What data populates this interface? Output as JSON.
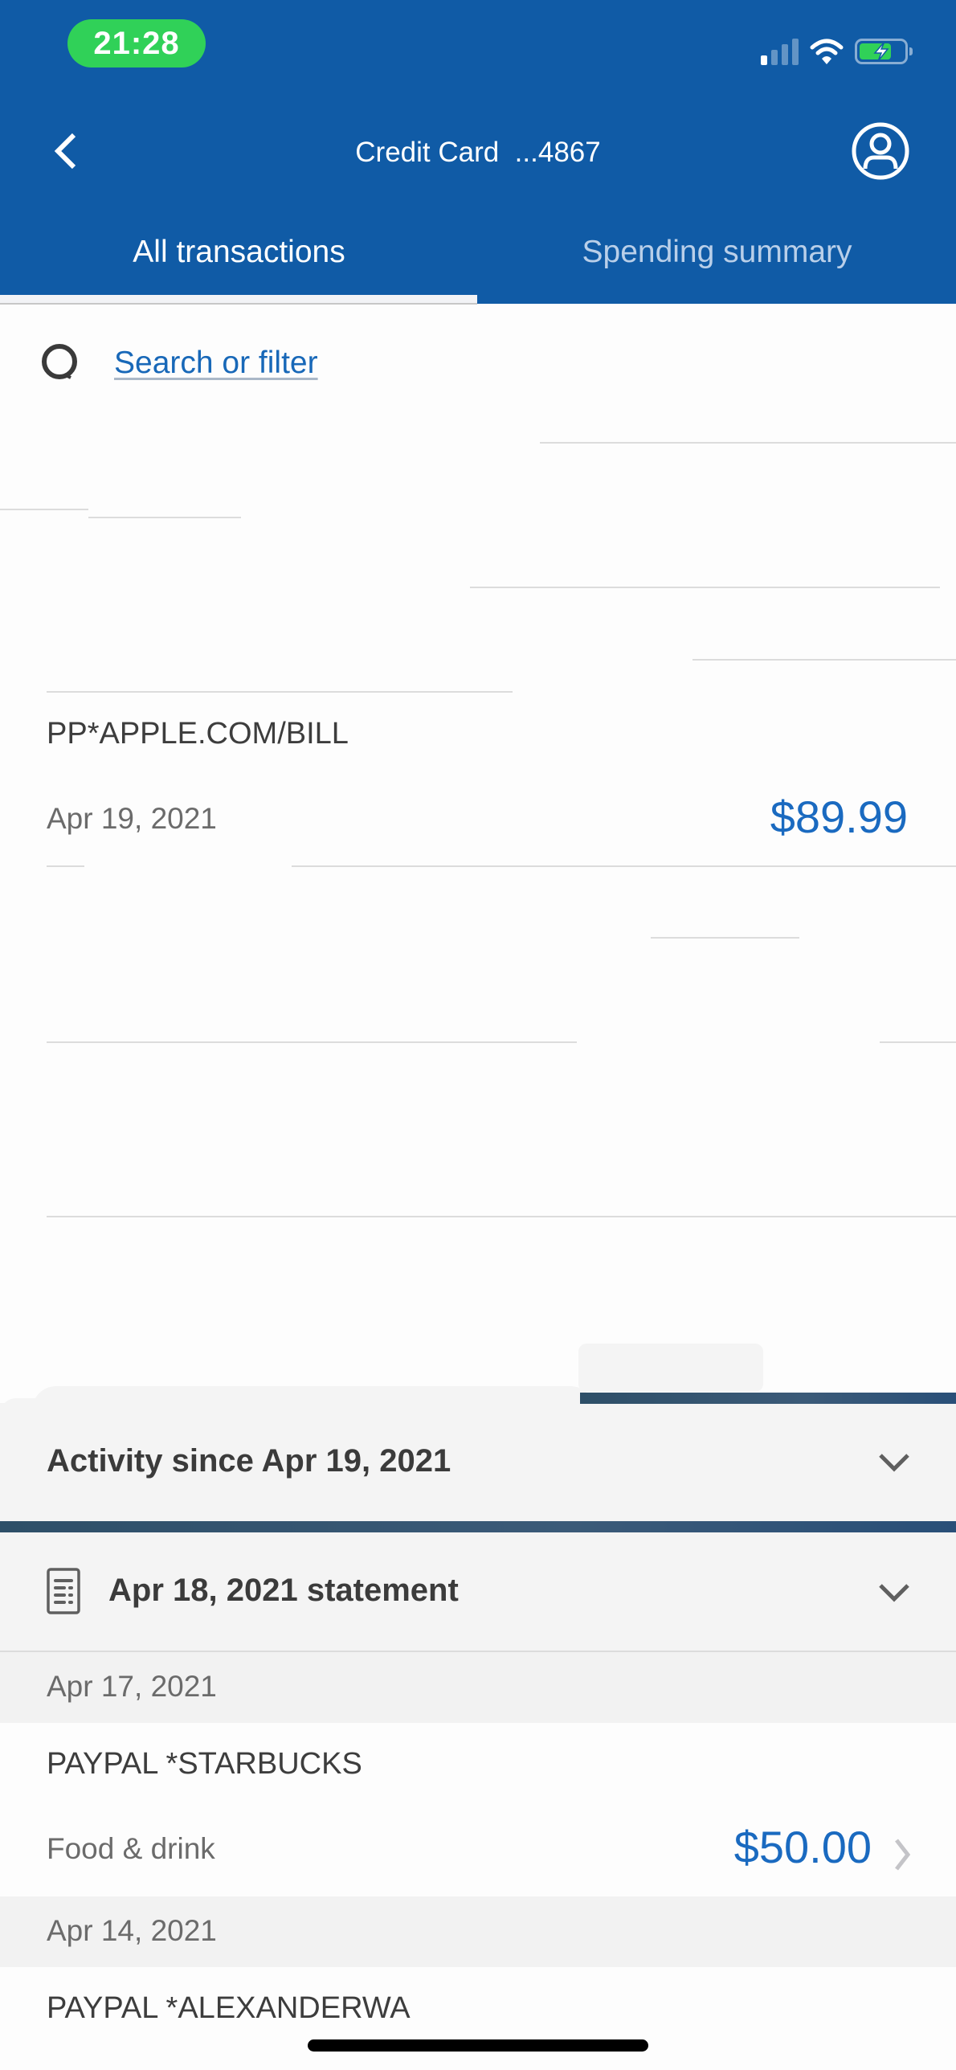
{
  "status_bar": {
    "time": "21:28",
    "signal_bars_on": 1,
    "signal_bars_total": 4,
    "wifi_icon": "wifi-icon",
    "battery_level": 0.75,
    "battery_charging": true
  },
  "nav": {
    "title": "Credit Card  ...4867",
    "back_icon": "chevron-left-icon",
    "profile_icon": "user-circle-icon"
  },
  "tabs": [
    {
      "label": "All transactions",
      "active": true
    },
    {
      "label": "Spending summary",
      "active": false
    }
  ],
  "search": {
    "label": "Search or filter",
    "icon": "search-icon"
  },
  "pending_transactions": [
    {
      "name": "PP*APPLE.COM/BILL",
      "date": "Apr 19, 2021",
      "amount": "$89.99"
    }
  ],
  "sections": {
    "activity": {
      "title": "Activity since Apr 19, 2021",
      "icon": "chevron-down-icon"
    },
    "statement": {
      "title": "Apr 18, 2021 statement",
      "icon": "statement-icon"
    }
  },
  "statement_transactions": [
    {
      "date": "Apr 17, 2021",
      "name": "PAYPAL *STARBUCKS",
      "category": "Food & drink",
      "amount": "$50.00"
    },
    {
      "date": "Apr 14, 2021",
      "name": "PAYPAL *ALEXANDERWA",
      "category": "",
      "amount": ""
    }
  ],
  "colors": {
    "brand_blue": "#105ba6",
    "amount_blue": "#1a6ac0",
    "time_pill_green": "#30d158",
    "section_gray": "#f4f4f4"
  }
}
